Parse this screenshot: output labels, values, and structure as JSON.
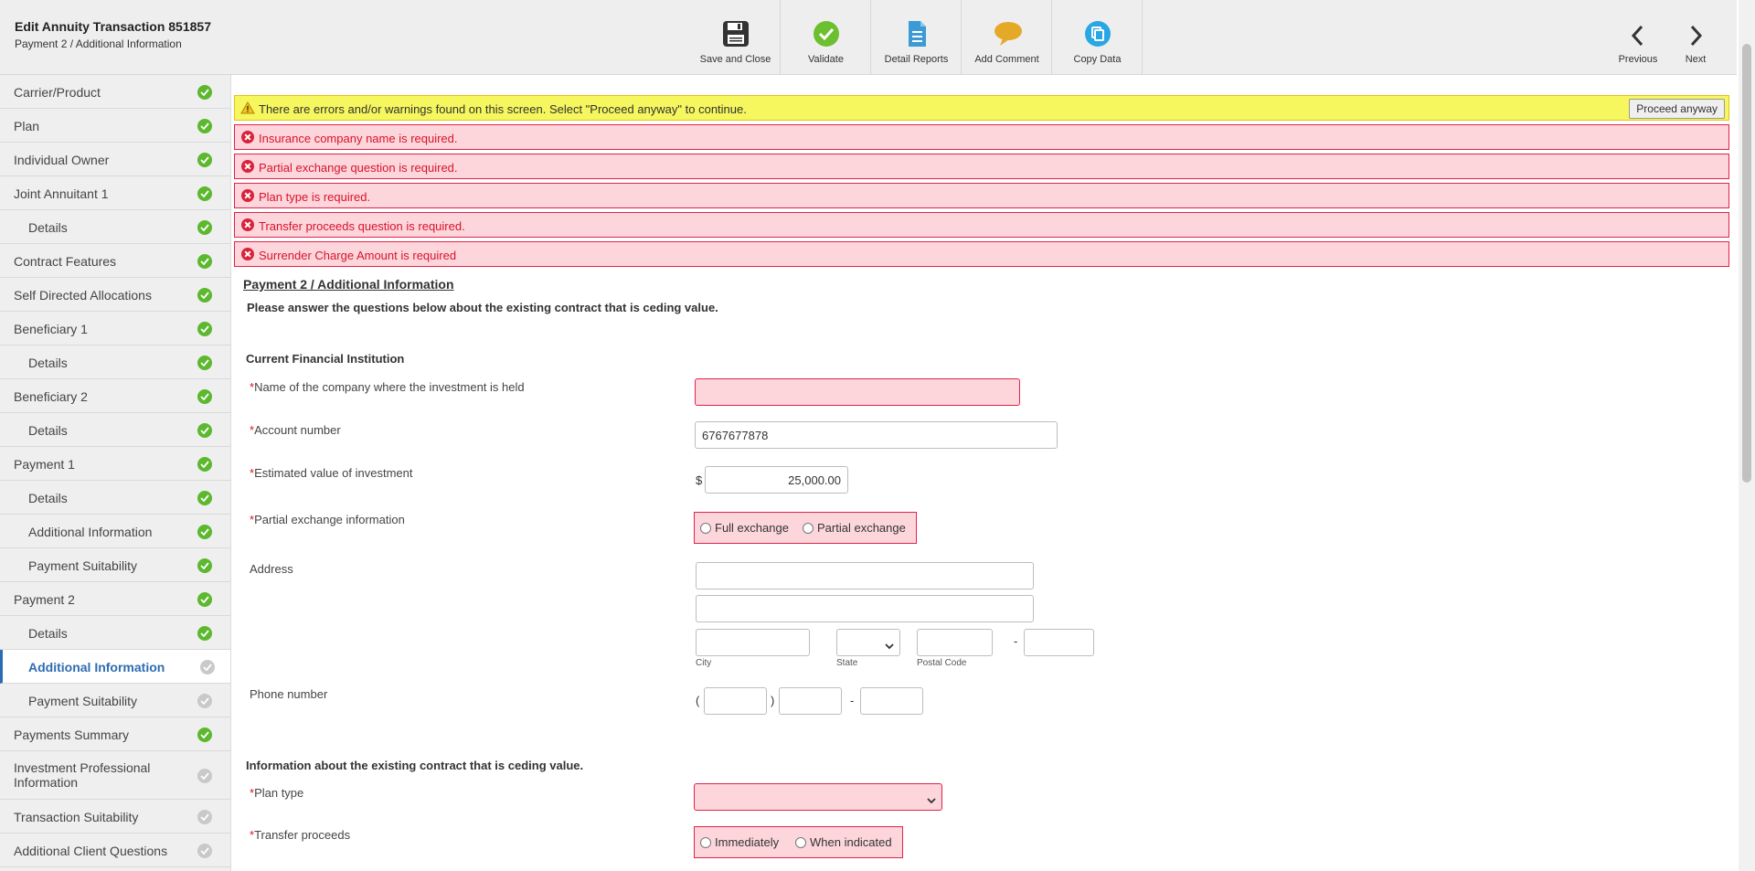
{
  "header": {
    "title": "Edit Annuity Transaction 851857",
    "subtitle": "Payment 2 / Additional Information",
    "toolbar": {
      "save_and_close": "Save and Close",
      "validate": "Validate",
      "detail_reports": "Detail Reports",
      "add_comment": "Add Comment",
      "copy_data": "Copy Data",
      "previous": "Previous",
      "next": "Next"
    }
  },
  "sidebar": {
    "items": [
      {
        "label": "Carrier/Product",
        "status": "complete"
      },
      {
        "label": "Plan",
        "status": "complete"
      },
      {
        "label": "Individual Owner",
        "status": "complete"
      },
      {
        "label": "Joint Annuitant 1",
        "status": "complete"
      },
      {
        "label": "Details",
        "status": "complete"
      },
      {
        "label": "Contract Features",
        "status": "complete"
      },
      {
        "label": "Self Directed Allocations",
        "status": "complete"
      },
      {
        "label": "Beneficiary 1",
        "status": "complete"
      },
      {
        "label": "Details",
        "status": "complete"
      },
      {
        "label": "Beneficiary 2",
        "status": "complete"
      },
      {
        "label": "Details",
        "status": "complete"
      },
      {
        "label": "Payment 1",
        "status": "complete"
      },
      {
        "label": "Details",
        "status": "complete"
      },
      {
        "label": "Additional Information",
        "status": "complete"
      },
      {
        "label": "Payment Suitability",
        "status": "complete"
      },
      {
        "label": "Payment 2",
        "status": "complete"
      },
      {
        "label": "Details",
        "status": "complete"
      },
      {
        "label": "Additional Information",
        "status": "incomplete",
        "active": true
      },
      {
        "label": "Payment Suitability",
        "status": "incomplete"
      },
      {
        "label": "Payments Summary",
        "status": "complete"
      },
      {
        "label": "Investment Professional Information",
        "status": "incomplete"
      },
      {
        "label": "Transaction Suitability",
        "status": "incomplete"
      },
      {
        "label": "Additional Client Questions",
        "status": "incomplete"
      }
    ]
  },
  "messages": {
    "warning": "There are errors and/or warnings found on this screen. Select \"Proceed anyway\" to continue.",
    "proceed_label": "Proceed anyway",
    "errors": [
      "Insurance company name is required.",
      "Partial exchange question is required.",
      "Plan type is required.",
      "Transfer proceeds question is required.",
      "Surrender Charge Amount is required"
    ]
  },
  "form": {
    "section_title": "Payment 2 / Additional Information",
    "intro": "Please answer the questions below about the existing contract that is ceding value.",
    "current_institution_heading": "Current Financial Institution",
    "company_name_label": "Name of the company where the investment is held",
    "company_name_value": "",
    "account_number_label": "Account number",
    "account_number_value": "6767677878",
    "estimated_value_label": "Estimated value of investment",
    "currency_symbol": "$",
    "estimated_value_value": "25,000.00",
    "partial_exchange_label": "Partial exchange information",
    "partial_exchange_options": [
      "Full exchange",
      "Partial exchange"
    ],
    "address_label": "Address",
    "address_line1": "",
    "address_line2": "",
    "city_label": "City",
    "state_label": "State",
    "postal_code_label": "Postal Code",
    "postal_dash": "-",
    "phone_label": "Phone number",
    "phone_open_paren": "(",
    "phone_close_paren": ")",
    "phone_dash": "-",
    "existing_contract_heading": "Information about the existing contract that is ceding value.",
    "plan_type_label": "Plan type",
    "transfer_proceeds_label": "Transfer proceeds",
    "transfer_proceeds_options": [
      "Immediately",
      "When indicated"
    ],
    "required_marker": "*"
  },
  "colors": {
    "error_bg": "#fdd6dc",
    "error_border": "#e0234a",
    "warning_bg": "#f6f65e",
    "complete_green": "#5cb82e",
    "active_blue": "#2d6cb0"
  }
}
